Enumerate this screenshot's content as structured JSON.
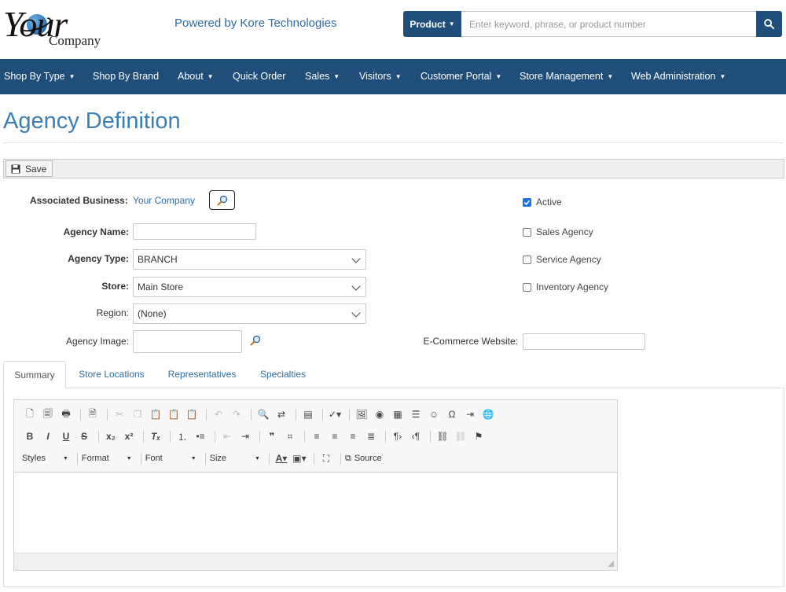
{
  "brand": {
    "logo_word": "Your",
    "logo_sub": "Company",
    "powered_by": "Powered by Kore Technologies"
  },
  "search": {
    "category_label": "Product",
    "placeholder": "Enter keyword, phrase, or product number"
  },
  "nav": {
    "items": [
      {
        "label": "Shop By Type",
        "dropdown": true
      },
      {
        "label": "Shop By Brand",
        "dropdown": false
      },
      {
        "label": "About",
        "dropdown": true
      },
      {
        "label": "Quick Order",
        "dropdown": false
      },
      {
        "label": "Sales",
        "dropdown": true
      },
      {
        "label": "Visitors",
        "dropdown": true
      },
      {
        "label": "Customer Portal",
        "dropdown": true
      },
      {
        "label": "Store Management",
        "dropdown": true
      },
      {
        "label": "Web Administration",
        "dropdown": true
      }
    ]
  },
  "page": {
    "title": "Agency Definition"
  },
  "toolbar": {
    "save_label": "Save"
  },
  "form": {
    "associated_business_label": "Associated Business:",
    "associated_business_value": "Your Company",
    "agency_name_label": "Agency Name:",
    "agency_name_value": "",
    "agency_type_label": "Agency Type:",
    "agency_type_value": "BRANCH",
    "store_label": "Store:",
    "store_value": "Main Store",
    "region_label": "Region:",
    "region_value": "(None)",
    "agency_image_label": "Agency Image:",
    "agency_image_value": "",
    "ecommerce_label": "E-Commerce Website:",
    "ecommerce_value": ""
  },
  "flags": {
    "active": {
      "label": "Active",
      "checked": true
    },
    "sales": {
      "label": "Sales Agency",
      "checked": false
    },
    "service": {
      "label": "Service Agency",
      "checked": false
    },
    "inventory": {
      "label": "Inventory Agency",
      "checked": false
    }
  },
  "tabs": [
    "Summary",
    "Store Locations",
    "Representatives",
    "Specialties"
  ],
  "editor": {
    "styles_label": "Styles",
    "format_label": "Format",
    "font_label": "Font",
    "size_label": "Size",
    "source_label": "Source"
  },
  "colors": {
    "nav_bg": "#1f4e7a",
    "title": "#3a7fb8",
    "link": "#2e6da4"
  }
}
